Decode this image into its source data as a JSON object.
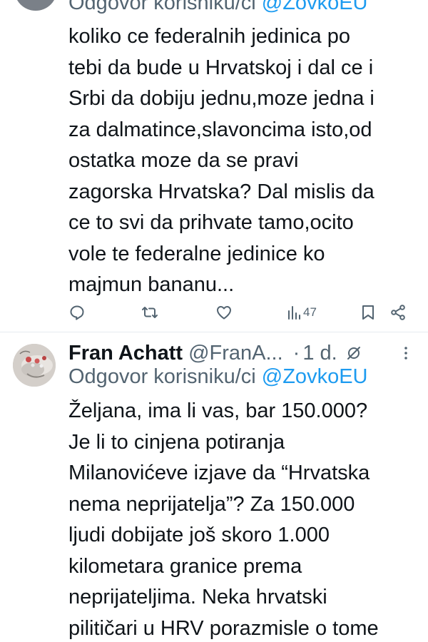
{
  "tweet1": {
    "reply_prefix": "Odgovor korisniku/ci",
    "reply_handle": "@ZovkoEU",
    "text": "koliko ce federalnih jedinica po\ntebi da bude u Hrvatskoj i dal ce i\nSrbi da dobiju jednu,moze jedna i\nza dalmatince,slavoncima isto,od\nostatka moze da se pravi\nzagorska Hrvatska? Dal mislis da\nce to svi da prihvate tamo,ocito\nvole te federalne jedinice ko\nmajmun bananu...",
    "views": "47",
    "icons": [
      "reply-icon",
      "retweet-icon",
      "like-icon",
      "views-icon",
      "bookmark-icon",
      "share-icon"
    ]
  },
  "tweet2": {
    "author_name": "Fran Achatt",
    "author_handle": "@FranA...",
    "separator": "·",
    "time": "1 d.",
    "reply_prefix": "Odgovor korisniku/ci",
    "reply_handle": "@ZovkoEU",
    "text": "Željana, ima li vas, bar 150.000?\nJe li to cinjena potiranja\nMilanovićeve izjave da “Hrvatska\nnema neprijatelja”? Za 150.000\nljudi dobijate još skoro 1.000\nkilometara granice prema\nneprijateljima. Neka hrvatski\npilitičari u HRV porazmisle o tome",
    "icons": [
      "edited-icon",
      "more-options-icon"
    ]
  },
  "colors": {
    "text": "#0f1419",
    "secondary": "#536471",
    "link": "#1d9bf0",
    "divider": "#e6ecf0"
  }
}
